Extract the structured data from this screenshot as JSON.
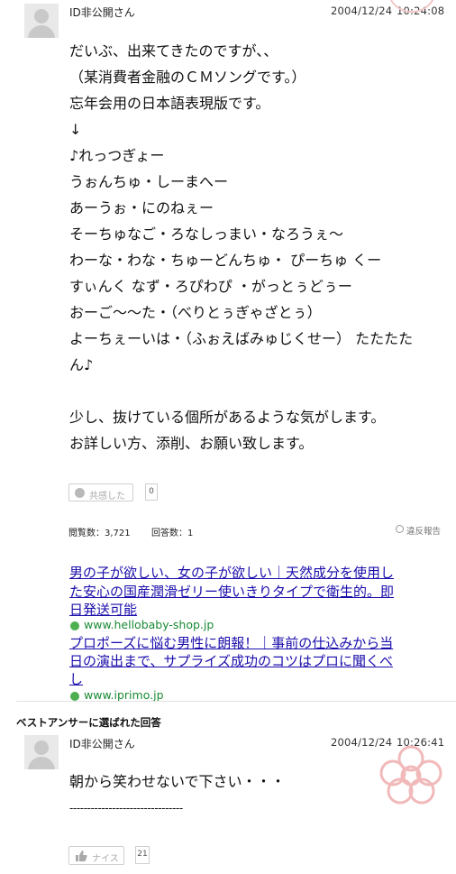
{
  "question": {
    "user_name": "ID非公開さん",
    "date": "2004/12/24",
    "time": "10:24:08",
    "body_lines": [
      "だいぶ、出来てきたのですが、、",
      "（某消費者金融のＣＭソングです。）",
      "忘年会用の日本語表現版です。",
      "↓",
      "♪れっつぎょー",
      "うぉんちゅ・しーまへー",
      "あーうぉ・にのねぇー",
      "そーちゅなご・ろなしっまい・なろうぇ～",
      "わーな・わな・ちゅーどんちゅ・ ぴーちゅ くー",
      "すぃんく なず・ろぴわぴ ・がっとぅどぅー",
      "おーご～～た・（べりとぅぎゃざとぅ）",
      "よーちぇーいは・（ふぉえばみゅじくせー） たたたた",
      "ん♪",
      "",
      "少し、抜けている個所があるような気がします。",
      "お詳しい方、添削、お願い致します。"
    ],
    "empathy_label": "共感した",
    "empathy_count": "0",
    "views_label": "閲覧数：3,721",
    "answers_label": "回答数：1",
    "report_label": "違反報告"
  },
  "ads": [
    {
      "title_lines": [
        "男の子が欲しい、女の子が欲しい｜天然成分を使用し",
        "た安心の国産潤滑ゼリー使いきりタイプで衛生的。即",
        "日発送可能"
      ],
      "url": "www.hellobaby-shop.jp"
    },
    {
      "title_lines": [
        "プロポーズに悩む男性に朗報！｜事前の仕込みから当",
        "日の演出まで、サプライズ成功のコツはプロに聞くべ",
        "し"
      ],
      "url": "www.iprimo.jp"
    }
  ],
  "best_answer": {
    "section_title": "ベストアンサーに選ばれた回答",
    "user_name": "ID非公開さん",
    "date": "2004/12/24",
    "time": "10:26:41",
    "body_lines": [
      "朝から笑わせないで下さい・・・",
      "--------------------------------"
    ],
    "nice_label": "ナイス",
    "nice_count": "21"
  },
  "colors": {
    "link": "#1a0dab",
    "url_green": "#1a8a34",
    "stamp_pink": "#f3c6c6"
  }
}
